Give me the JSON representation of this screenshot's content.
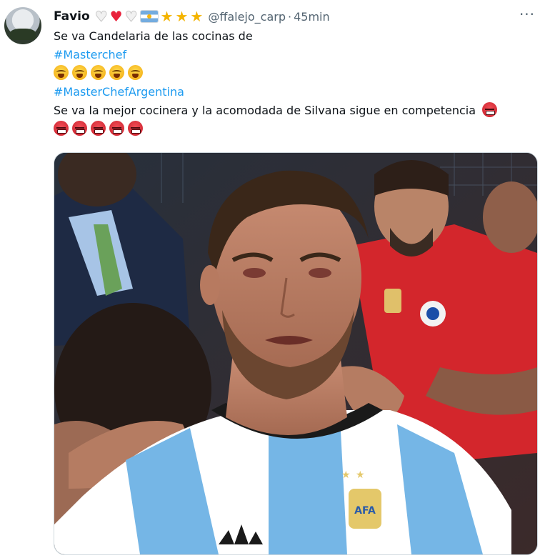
{
  "tweet": {
    "author": {
      "name": "Favio",
      "handle": "@ffalejo_carp",
      "name_emojis": [
        "white-heart-icon",
        "red-heart-icon",
        "white-heart-icon",
        "argentina-flag-icon",
        "star-icon",
        "star-icon",
        "star-icon"
      ]
    },
    "separator": "·",
    "time": "45min",
    "more_label": "···",
    "text": {
      "line1": "Se va Candelaria de las cocinas de",
      "hashtag1": "#Masterchef",
      "sob_count": 5,
      "hashtag2": "#MasterChefArgentina",
      "line2": "Se va la mejor cocinera y la acomodada de Silvana sigue en competencia",
      "angry_count_trailing": 1,
      "angry_count_row": 5
    },
    "media": {
      "type": "photo",
      "subject": "crying-football-player-photo"
    }
  },
  "colors": {
    "link": "#1d9bf0",
    "secondary_text": "#536471",
    "heart_red": "#e8213b",
    "star": "#f4b400"
  }
}
